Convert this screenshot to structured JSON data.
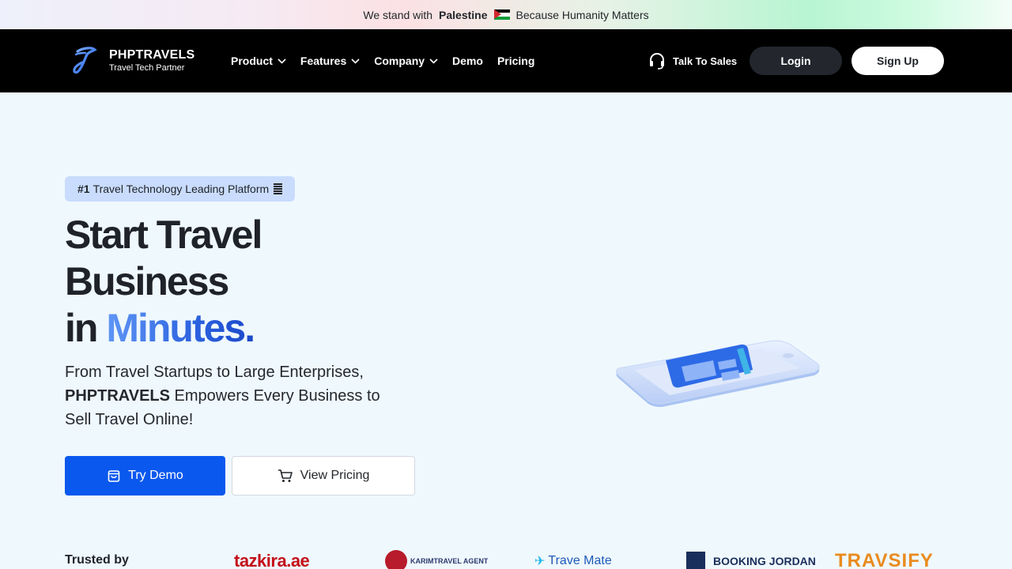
{
  "announcement": {
    "prefix": "We stand with",
    "highlight": "Palestine",
    "suffix": "Because Humanity Matters"
  },
  "header": {
    "logo_name": "PHPTRAVELS",
    "logo_tagline": "Travel Tech Partner",
    "nav": [
      {
        "label": "Product",
        "has_dropdown": true
      },
      {
        "label": "Features",
        "has_dropdown": true
      },
      {
        "label": "Company",
        "has_dropdown": true
      },
      {
        "label": "Demo",
        "has_dropdown": false
      },
      {
        "label": "Pricing",
        "has_dropdown": false
      }
    ],
    "talk_to_sales": "Talk To Sales",
    "login": "Login",
    "signup": "Sign Up"
  },
  "hero": {
    "badge_rank": "#1",
    "badge_text": "Travel Technology Leading Platform",
    "headline_line1": "Start Travel",
    "headline_line2": "Business",
    "headline_line3_prefix": "in",
    "headline_line3_accent": "Minutes.",
    "sub_line1": "From Travel Startups to Large Enterprises,",
    "sub_brand": "PHPTRAVELS",
    "sub_line2_rest": "Empowers Every Business to",
    "sub_line3": "Sell Travel Online!",
    "try_demo": "Try Demo",
    "view_pricing": "View Pricing"
  },
  "trusted": {
    "label": "Trusted by",
    "brands": [
      "tazkira.ae",
      "KARIMTRAVEL AGENT",
      "Trave Mate",
      "BOOKING JORDAN",
      "TRAVSIFY"
    ]
  },
  "colors": {
    "accent_blue": "#0a58ee",
    "nav_bg": "#000000",
    "page_bg": "#eff8fd",
    "badge_bg": "#c9dcfd"
  }
}
